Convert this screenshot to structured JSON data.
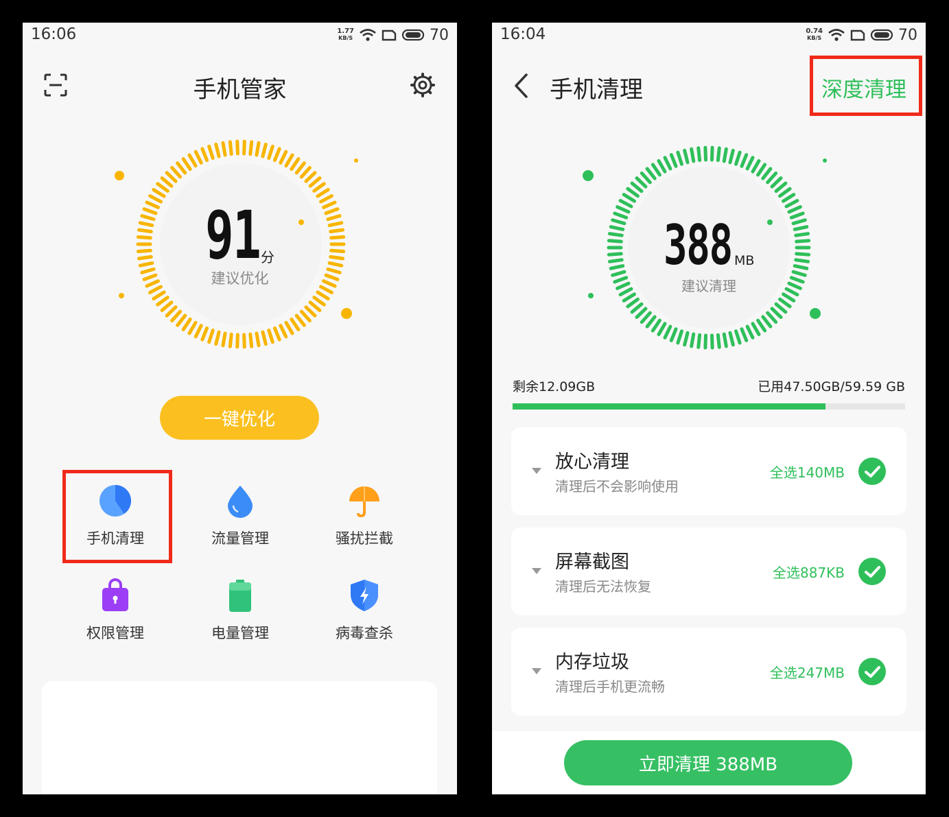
{
  "left": {
    "status": {
      "time": "16:06",
      "speed_top": "1.77",
      "speed_unit": "KB/S",
      "battery": "70"
    },
    "header": {
      "title": "手机管家"
    },
    "score": {
      "value": "91",
      "unit": "分",
      "subtitle": "建议优化"
    },
    "optimize_button": "一键优化",
    "grid": [
      {
        "label": "手机清理",
        "icon": "pie-icon"
      },
      {
        "label": "流量管理",
        "icon": "drop-icon"
      },
      {
        "label": "骚扰拦截",
        "icon": "umbrella-icon"
      },
      {
        "label": "权限管理",
        "icon": "bag-lock-icon"
      },
      {
        "label": "电量管理",
        "icon": "battery-icon"
      },
      {
        "label": "病毒查杀",
        "icon": "shield-bolt-icon"
      }
    ]
  },
  "right": {
    "status": {
      "time": "16:04",
      "speed_top": "0.74",
      "speed_unit": "KB/S",
      "battery": "70"
    },
    "header": {
      "title": "手机清理",
      "deep_clean": "深度清理"
    },
    "gauge": {
      "value": "388",
      "unit": "MB",
      "subtitle": "建议清理"
    },
    "storage": {
      "remaining": "剩余12.09GB",
      "used": "已用47.50GB/59.59 GB",
      "used_fraction": 0.797
    },
    "cards": [
      {
        "title": "放心清理",
        "sub": "清理后不会影响使用",
        "value": "全选140MB"
      },
      {
        "title": "屏幕截图",
        "sub": "清理后无法恢复",
        "value": "全选887KB"
      },
      {
        "title": "内存垃圾",
        "sub": "清理后手机更流畅",
        "value": "全选247MB"
      }
    ],
    "clean_button": "立即清理 388MB"
  },
  "colors": {
    "orange": "#f7b500",
    "green": "#2fbf5a",
    "red_highlight": "#f02a1a"
  }
}
